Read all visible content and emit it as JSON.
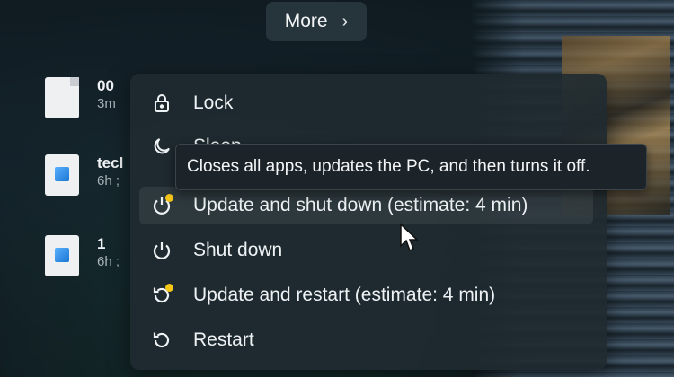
{
  "start_menu": {
    "more_button": {
      "label": "More",
      "icon": "chevron-right-icon"
    },
    "recent_files": [
      {
        "name": "00",
        "time": "3m",
        "icon": "document-icon"
      },
      {
        "name": "tecl",
        "time": "6h ;",
        "icon": "image-file-icon"
      },
      {
        "name": "1",
        "time": "6h ;",
        "icon": "image-file-icon"
      }
    ]
  },
  "power_menu": {
    "items": [
      {
        "label": "Lock",
        "icon": "lock-icon"
      },
      {
        "label": "Sleep",
        "icon": "moon-icon"
      },
      {
        "label": "Update and shut down (estimate: 4 min)",
        "icon": "power-update-icon",
        "hovered": true
      },
      {
        "label": "Shut down",
        "icon": "power-icon"
      },
      {
        "label": "Update and restart (estimate: 4 min)",
        "icon": "restart-update-icon"
      },
      {
        "label": "Restart",
        "icon": "restart-icon"
      }
    ],
    "tooltip": "Closes all apps, updates the PC, and then turns it off."
  },
  "colors": {
    "update_badge": "#f5c518",
    "menu_bg": "#202a30",
    "text": "#eef2f4"
  }
}
